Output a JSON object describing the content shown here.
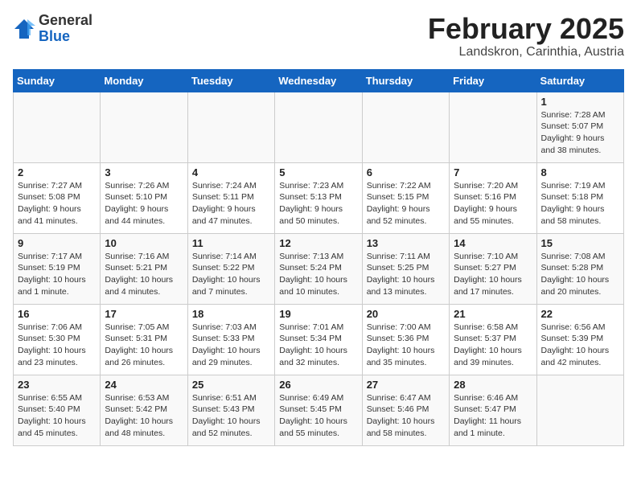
{
  "logo": {
    "general": "General",
    "blue": "Blue"
  },
  "title": "February 2025",
  "subtitle": "Landskron, Carinthia, Austria",
  "weekdays": [
    "Sunday",
    "Monday",
    "Tuesday",
    "Wednesday",
    "Thursday",
    "Friday",
    "Saturday"
  ],
  "weeks": [
    [
      {
        "day": "",
        "info": ""
      },
      {
        "day": "",
        "info": ""
      },
      {
        "day": "",
        "info": ""
      },
      {
        "day": "",
        "info": ""
      },
      {
        "day": "",
        "info": ""
      },
      {
        "day": "",
        "info": ""
      },
      {
        "day": "1",
        "info": "Sunrise: 7:28 AM\nSunset: 5:07 PM\nDaylight: 9 hours and 38 minutes."
      }
    ],
    [
      {
        "day": "2",
        "info": "Sunrise: 7:27 AM\nSunset: 5:08 PM\nDaylight: 9 hours and 41 minutes."
      },
      {
        "day": "3",
        "info": "Sunrise: 7:26 AM\nSunset: 5:10 PM\nDaylight: 9 hours and 44 minutes."
      },
      {
        "day": "4",
        "info": "Sunrise: 7:24 AM\nSunset: 5:11 PM\nDaylight: 9 hours and 47 minutes."
      },
      {
        "day": "5",
        "info": "Sunrise: 7:23 AM\nSunset: 5:13 PM\nDaylight: 9 hours and 50 minutes."
      },
      {
        "day": "6",
        "info": "Sunrise: 7:22 AM\nSunset: 5:15 PM\nDaylight: 9 hours and 52 minutes."
      },
      {
        "day": "7",
        "info": "Sunrise: 7:20 AM\nSunset: 5:16 PM\nDaylight: 9 hours and 55 minutes."
      },
      {
        "day": "8",
        "info": "Sunrise: 7:19 AM\nSunset: 5:18 PM\nDaylight: 9 hours and 58 minutes."
      }
    ],
    [
      {
        "day": "9",
        "info": "Sunrise: 7:17 AM\nSunset: 5:19 PM\nDaylight: 10 hours and 1 minute."
      },
      {
        "day": "10",
        "info": "Sunrise: 7:16 AM\nSunset: 5:21 PM\nDaylight: 10 hours and 4 minutes."
      },
      {
        "day": "11",
        "info": "Sunrise: 7:14 AM\nSunset: 5:22 PM\nDaylight: 10 hours and 7 minutes."
      },
      {
        "day": "12",
        "info": "Sunrise: 7:13 AM\nSunset: 5:24 PM\nDaylight: 10 hours and 10 minutes."
      },
      {
        "day": "13",
        "info": "Sunrise: 7:11 AM\nSunset: 5:25 PM\nDaylight: 10 hours and 13 minutes."
      },
      {
        "day": "14",
        "info": "Sunrise: 7:10 AM\nSunset: 5:27 PM\nDaylight: 10 hours and 17 minutes."
      },
      {
        "day": "15",
        "info": "Sunrise: 7:08 AM\nSunset: 5:28 PM\nDaylight: 10 hours and 20 minutes."
      }
    ],
    [
      {
        "day": "16",
        "info": "Sunrise: 7:06 AM\nSunset: 5:30 PM\nDaylight: 10 hours and 23 minutes."
      },
      {
        "day": "17",
        "info": "Sunrise: 7:05 AM\nSunset: 5:31 PM\nDaylight: 10 hours and 26 minutes."
      },
      {
        "day": "18",
        "info": "Sunrise: 7:03 AM\nSunset: 5:33 PM\nDaylight: 10 hours and 29 minutes."
      },
      {
        "day": "19",
        "info": "Sunrise: 7:01 AM\nSunset: 5:34 PM\nDaylight: 10 hours and 32 minutes."
      },
      {
        "day": "20",
        "info": "Sunrise: 7:00 AM\nSunset: 5:36 PM\nDaylight: 10 hours and 35 minutes."
      },
      {
        "day": "21",
        "info": "Sunrise: 6:58 AM\nSunset: 5:37 PM\nDaylight: 10 hours and 39 minutes."
      },
      {
        "day": "22",
        "info": "Sunrise: 6:56 AM\nSunset: 5:39 PM\nDaylight: 10 hours and 42 minutes."
      }
    ],
    [
      {
        "day": "23",
        "info": "Sunrise: 6:55 AM\nSunset: 5:40 PM\nDaylight: 10 hours and 45 minutes."
      },
      {
        "day": "24",
        "info": "Sunrise: 6:53 AM\nSunset: 5:42 PM\nDaylight: 10 hours and 48 minutes."
      },
      {
        "day": "25",
        "info": "Sunrise: 6:51 AM\nSunset: 5:43 PM\nDaylight: 10 hours and 52 minutes."
      },
      {
        "day": "26",
        "info": "Sunrise: 6:49 AM\nSunset: 5:45 PM\nDaylight: 10 hours and 55 minutes."
      },
      {
        "day": "27",
        "info": "Sunrise: 6:47 AM\nSunset: 5:46 PM\nDaylight: 10 hours and 58 minutes."
      },
      {
        "day": "28",
        "info": "Sunrise: 6:46 AM\nSunset: 5:47 PM\nDaylight: 11 hours and 1 minute."
      },
      {
        "day": "",
        "info": ""
      }
    ]
  ]
}
